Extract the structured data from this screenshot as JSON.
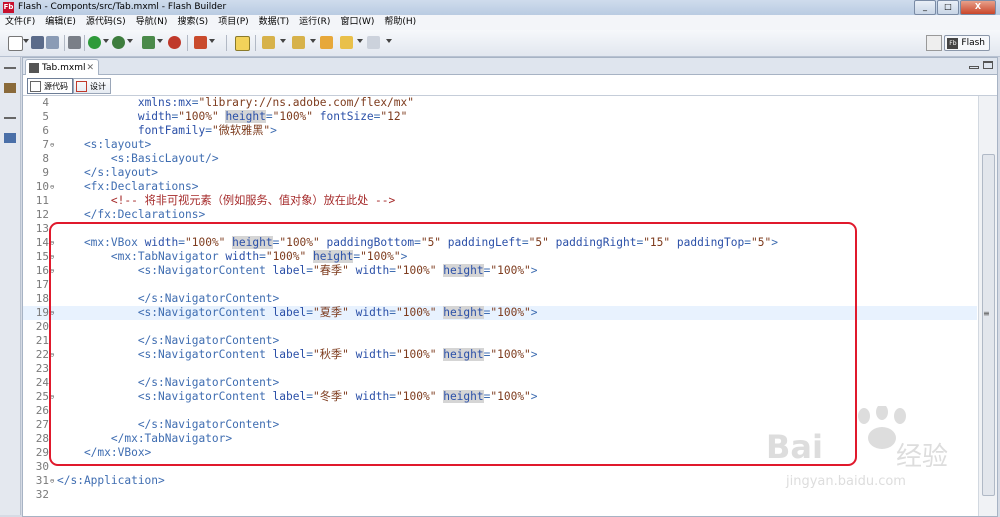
{
  "window": {
    "title": "Flash - Componts/src/Tab.mxml - Flash Builder",
    "min_glyph": "_",
    "max_glyph": "□",
    "close_glyph": "X"
  },
  "menu": [
    "文件(F)",
    "编辑(E)",
    "源代码(S)",
    "导航(N)",
    "搜索(S)",
    "项目(P)",
    "数据(T)",
    "运行(R)",
    "窗口(W)",
    "帮助(H)"
  ],
  "perspective": {
    "label": "Flash"
  },
  "editor": {
    "tab_label": "Tab.mxml",
    "tab_close": "✕",
    "modes": {
      "source": "源代码",
      "design": "设计"
    }
  },
  "code_lines": [
    {
      "n": "4",
      "fold": "",
      "text": "            xmlns:mx=\"library://ns.adobe.com/flex/mx\""
    },
    {
      "n": "5",
      "fold": "",
      "text": "            width=\"100%\" height=\"100%\" fontSize=\"12\""
    },
    {
      "n": "6",
      "fold": "",
      "text": "            fontFamily=\"微软雅黑\">"
    },
    {
      "n": "7",
      "fold": "⊖",
      "text": "    <s:layout>"
    },
    {
      "n": "8",
      "fold": "",
      "text": "        <s:BasicLayout/>"
    },
    {
      "n": "9",
      "fold": "",
      "text": "    </s:layout>"
    },
    {
      "n": "10",
      "fold": "⊖",
      "text": "    <fx:Declarations>"
    },
    {
      "n": "11",
      "fold": "",
      "text": "        <!-- 将非可视元素（例如服务、值对象）放在此处 -->"
    },
    {
      "n": "12",
      "fold": "",
      "text": "    </fx:Declarations>"
    },
    {
      "n": "13",
      "fold": "",
      "text": ""
    },
    {
      "n": "14",
      "fold": "⊖",
      "text": "    <mx:VBox width=\"100%\" height=\"100%\" paddingBottom=\"5\" paddingLeft=\"5\" paddingRight=\"15\" paddingTop=\"5\">"
    },
    {
      "n": "15",
      "fold": "⊖",
      "text": "        <mx:TabNavigator width=\"100%\" height=\"100%\">"
    },
    {
      "n": "16",
      "fold": "⊖",
      "text": "            <s:NavigatorContent label=\"春季\" width=\"100%\" height=\"100%\">"
    },
    {
      "n": "17",
      "fold": "",
      "text": ""
    },
    {
      "n": "18",
      "fold": "",
      "text": "            </s:NavigatorContent>"
    },
    {
      "n": "19",
      "fold": "⊖",
      "text": "            <s:NavigatorContent label=\"夏季\" width=\"100%\" height=\"100%\">"
    },
    {
      "n": "20",
      "fold": "",
      "text": ""
    },
    {
      "n": "21",
      "fold": "",
      "text": "            </s:NavigatorContent>"
    },
    {
      "n": "22",
      "fold": "⊖",
      "text": "            <s:NavigatorContent label=\"秋季\" width=\"100%\" height=\"100%\">"
    },
    {
      "n": "23",
      "fold": "",
      "text": ""
    },
    {
      "n": "24",
      "fold": "",
      "text": "            </s:NavigatorContent>"
    },
    {
      "n": "25",
      "fold": "⊖",
      "text": "            <s:NavigatorContent label=\"冬季\" width=\"100%\" height=\"100%\">"
    },
    {
      "n": "26",
      "fold": "",
      "text": ""
    },
    {
      "n": "27",
      "fold": "",
      "text": "            </s:NavigatorContent>"
    },
    {
      "n": "28",
      "fold": "",
      "text": "        </mx:TabNavigator>"
    },
    {
      "n": "29",
      "fold": "",
      "text": "    </mx:VBox>"
    },
    {
      "n": "30",
      "fold": "",
      "text": ""
    },
    {
      "n": "31",
      "fold": "⊖",
      "text": "</s:Application>"
    },
    {
      "n": "32",
      "fold": "",
      "text": ""
    }
  ],
  "current_line": "19",
  "watermark": {
    "brand": "Bai",
    "brand2": "经验",
    "url": "jingyan.baidu.com"
  },
  "colors": {
    "annotation_box": "#e0192c",
    "current_line": "#e8f2fe",
    "tag": "#3f6db1",
    "attr_value": "#7d3b1d"
  }
}
